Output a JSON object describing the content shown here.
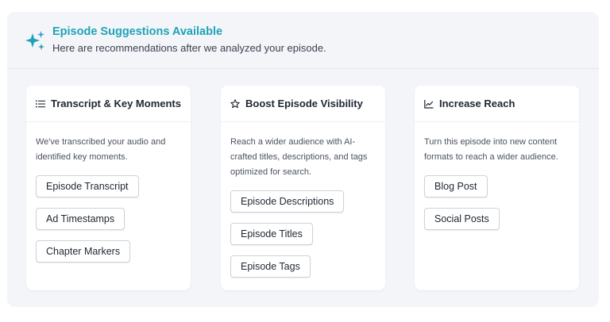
{
  "header": {
    "title": "Episode Suggestions Available",
    "subtitle": "Here are recommendations after we analyzed your episode."
  },
  "colors": {
    "accent": "#1fa3b8",
    "panel_bg": "#f3f5f8",
    "card_bg": "#ffffff"
  },
  "cards": [
    {
      "icon": "list-icon",
      "title": "Transcript & Key Moments",
      "description_lines": [
        "We've transcribed your audio and",
        "identified key moments."
      ],
      "buttons": [
        "Episode Transcript",
        "Ad Timestamps",
        "Chapter Markers"
      ]
    },
    {
      "icon": "star-icon",
      "title": "Boost Episode Visibility",
      "description_lines": [
        "Reach a wider audience with AI-",
        "crafted titles, descriptions, and tags",
        "optimized for search."
      ],
      "buttons": [
        "Episode Descriptions",
        "Episode Titles",
        "Episode Tags"
      ]
    },
    {
      "icon": "trending-chart-icon",
      "title": "Increase Reach",
      "description_lines": [
        "Turn this episode into new content",
        "formats to reach a wider audience."
      ],
      "buttons": [
        "Blog Post",
        "Social Posts"
      ]
    }
  ]
}
